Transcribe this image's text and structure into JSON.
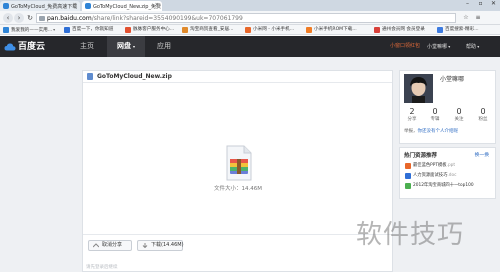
{
  "browser": {
    "tabs": [
      {
        "title": "GoToMyCloud_免费高速下载",
        "active": false
      },
      {
        "title": "GoToMyCloud_New.zip_免费",
        "active": true
      }
    ],
    "url": {
      "host": "pan.baidu.com",
      "path": "/share/link?shareid=3554090199&uk=707061799"
    },
    "bookmarks": [
      {
        "label": "我爱我的——实用...",
        "icon_color": "#2f84d6"
      },
      {
        "label": "百度一下，你就知道",
        "icon_color": "#2f6fd6"
      },
      {
        "label": "脉脉客户服务中心...",
        "icon_color": "#e2502f"
      },
      {
        "label": "淘宝商贸查看_安居...",
        "icon_color": "#e08a2c"
      },
      {
        "label": "小米网 - 小米手机...",
        "icon_color": "#e8672a"
      },
      {
        "label": "小米手机ROM下载...",
        "icon_color": "#f07c24"
      },
      {
        "label": "通州会员网 会员登录",
        "icon_color": "#d8403a"
      },
      {
        "label": "百度搜索-精彩...",
        "icon_color": "#3d7be0"
      }
    ]
  },
  "header": {
    "logo": "百度云",
    "nav": [
      {
        "label": "主页",
        "active": false
      },
      {
        "label": "网盘",
        "active": true
      },
      {
        "label": "应用",
        "active": false
      }
    ],
    "right": {
      "msg": "小窗口领红包",
      "user": "小堂嘛哪",
      "more": "帮助"
    }
  },
  "file": {
    "name": "GoToMyCloud_New.zip",
    "size_text": "文件大小：14.46M",
    "buttons": {
      "save": "取消分享",
      "download": "下载(14.46M)"
    },
    "faint_text": "请先登录后继续"
  },
  "profile": {
    "name": "小堂嘛哪",
    "stats": [
      {
        "num": "2",
        "label": "分享"
      },
      {
        "num": "0",
        "label": "专辑"
      },
      {
        "num": "0",
        "label": "关注"
      },
      {
        "num": "0",
        "label": "粉丝"
      }
    ],
    "report_prefix": "举报，",
    "report_link": "你还没有个人介绍呢"
  },
  "hot": {
    "title": "热门资源推荐",
    "refresh": "换一换",
    "items": [
      {
        "label": "最佳蓝色PPT模板",
        "ext": ".ppt",
        "icon_color": "#e8672a"
      },
      {
        "label": "人力资源面试技巧",
        "ext": ".doc",
        "icon_color": "#2f6fd6"
      },
      {
        "label": "2012年淘宝商城四十一top100",
        "ext": "",
        "icon_color": "#4caf50"
      }
    ]
  },
  "watermark": "软件技巧"
}
